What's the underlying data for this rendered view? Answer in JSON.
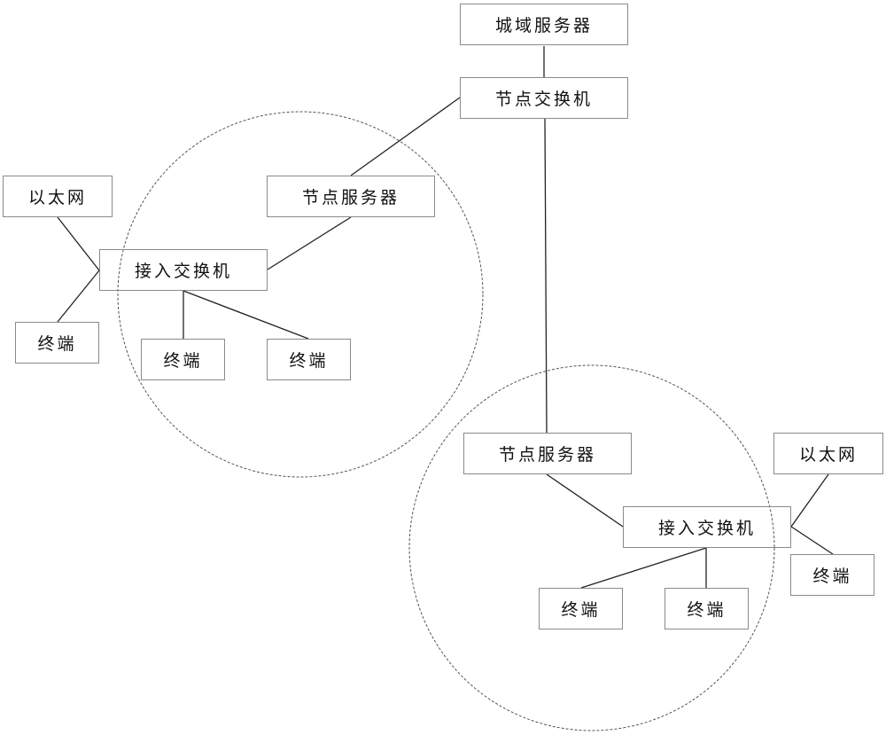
{
  "diagram": {
    "type": "network-topology",
    "nodes": {
      "city_server": "城域服务器",
      "node_switch": "节点交换机",
      "left_node_server": "节点服务器",
      "left_access_switch": "接入交换机",
      "left_ethernet": "以太网",
      "left_terminal_outer": "终端",
      "left_terminal_1": "终端",
      "left_terminal_2": "终端",
      "right_node_server": "节点服务器",
      "right_access_switch": "接入交换机",
      "right_ethernet": "以太网",
      "right_terminal_outer": "终端",
      "right_terminal_1": "终端",
      "right_terminal_2": "终端"
    },
    "edges": [
      [
        "city_server",
        "node_switch"
      ],
      [
        "node_switch",
        "left_node_server"
      ],
      [
        "node_switch",
        "right_node_server"
      ],
      [
        "left_node_server",
        "left_access_switch"
      ],
      [
        "left_ethernet",
        "left_access_switch"
      ],
      [
        "left_terminal_outer",
        "left_access_switch"
      ],
      [
        "left_access_switch",
        "left_terminal_1"
      ],
      [
        "left_access_switch",
        "left_terminal_2"
      ],
      [
        "right_node_server",
        "right_access_switch"
      ],
      [
        "right_ethernet",
        "right_access_switch"
      ],
      [
        "right_terminal_outer",
        "right_access_switch"
      ],
      [
        "right_access_switch",
        "right_terminal_1"
      ],
      [
        "right_access_switch",
        "right_terminal_2"
      ]
    ],
    "groups": [
      "left-domain",
      "right-domain"
    ]
  }
}
